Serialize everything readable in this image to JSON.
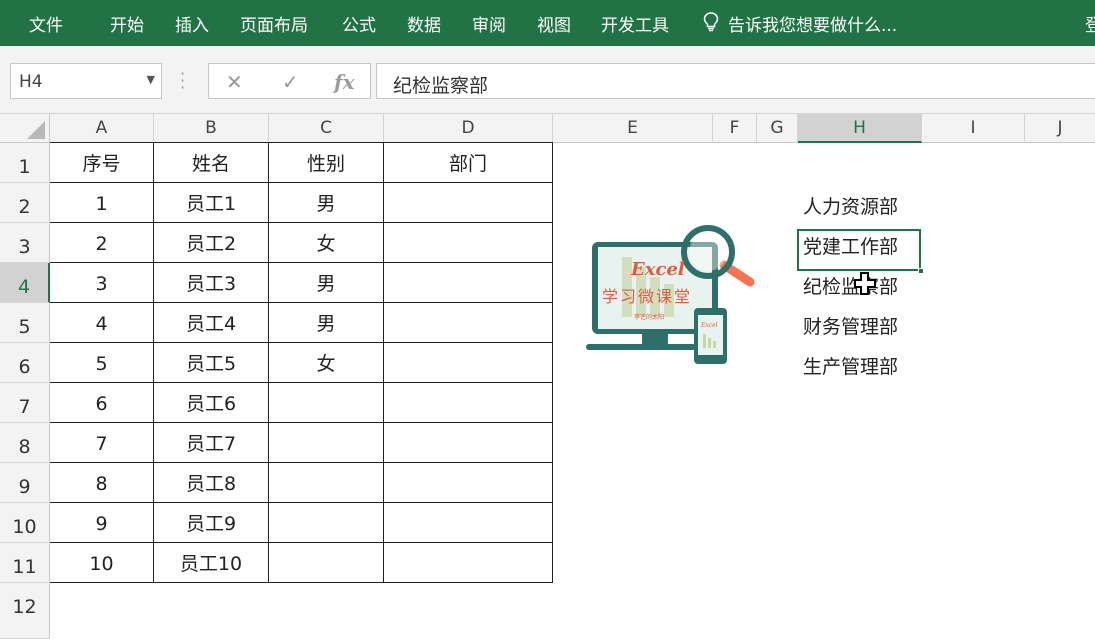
{
  "ribbon": {
    "tabs": [
      "文件",
      "开始",
      "插入",
      "页面布局",
      "公式",
      "数据",
      "审阅",
      "视图",
      "开发工具"
    ],
    "tell_me": "告诉我您想要做什么...",
    "right_partial": "登",
    "bg_color": "#217346"
  },
  "formula_bar": {
    "name_box": "H4",
    "cancel_icon": "✕",
    "enter_icon": "✓",
    "fx_label": "fx",
    "formula": "纪检监察部"
  },
  "columns": [
    "A",
    "B",
    "C",
    "D",
    "E",
    "F",
    "G",
    "H",
    "I",
    "J"
  ],
  "selected_column": "H",
  "rows": [
    "1",
    "2",
    "3",
    "4",
    "5",
    "6",
    "7",
    "8",
    "9",
    "10",
    "11",
    "12"
  ],
  "selected_row": "4",
  "table": {
    "headers": [
      "序号",
      "姓名",
      "性别",
      "部门"
    ],
    "rows": [
      [
        "1",
        "员工1",
        "男",
        ""
      ],
      [
        "2",
        "员工2",
        "女",
        ""
      ],
      [
        "3",
        "员工3",
        "男",
        ""
      ],
      [
        "4",
        "员工4",
        "男",
        ""
      ],
      [
        "5",
        "员工5",
        "女",
        ""
      ],
      [
        "6",
        "员工6",
        "",
        ""
      ],
      [
        "7",
        "员工7",
        "",
        ""
      ],
      [
        "8",
        "员工8",
        "",
        ""
      ],
      [
        "9",
        "员工9",
        "",
        ""
      ],
      [
        "10",
        "员工10",
        "",
        ""
      ]
    ]
  },
  "departments": [
    "人力资源部",
    "党建工作部",
    "纪检监察部",
    "财务管理部",
    "生产管理部"
  ],
  "logo": {
    "title": "Excel",
    "subtitle": "学习微课堂",
    "small": "李艺的太阳"
  }
}
